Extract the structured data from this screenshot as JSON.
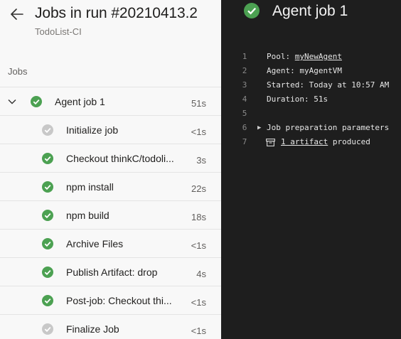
{
  "header": {
    "title": "Jobs in run #20210413.2",
    "subtitle": "TodoList-CI"
  },
  "jobs_section": {
    "label": "Jobs",
    "job": {
      "name": "Agent job 1",
      "duration": "51s",
      "status": "succeeded"
    },
    "steps": [
      {
        "name": "Initialize job",
        "duration": "<1s",
        "status": "skipped"
      },
      {
        "name": "Checkout thinkC/todolist",
        "display": "Checkout thinkC/todoli...",
        "duration": "3s",
        "status": "succeeded"
      },
      {
        "name": "npm install",
        "duration": "22s",
        "status": "succeeded"
      },
      {
        "name": "npm build",
        "duration": "18s",
        "status": "succeeded"
      },
      {
        "name": "Archive Files",
        "duration": "<1s",
        "status": "succeeded"
      },
      {
        "name": "Publish Artifact: drop",
        "duration": "4s",
        "status": "succeeded"
      },
      {
        "name": "Post-job: Checkout thinkC/todolist",
        "display": "Post-job: Checkout thi...",
        "duration": "<1s",
        "status": "succeeded"
      },
      {
        "name": "Finalize Job",
        "duration": "<1s",
        "status": "skipped"
      }
    ]
  },
  "detail": {
    "title": "Agent job 1",
    "log": {
      "line_numbers": [
        "1",
        "2",
        "3",
        "4",
        "5",
        "6",
        "7"
      ],
      "pool_label": "Pool: ",
      "pool_value": "myNewAgent",
      "agent_text": "Agent: myAgentVM",
      "started_text": "Started: Today at 10:57 AM",
      "duration_text": "Duration: 51s",
      "job_prep_text": "Job preparation parameters",
      "artifact_link": "1 artifact",
      "artifact_suffix": " produced"
    }
  },
  "colors": {
    "success": "#4ca152",
    "skipped": "#c8c8c8",
    "left_bg": "#f8f8f8",
    "right_bg": "#1e1e1e"
  },
  "icons": {
    "back": "arrow-left-icon",
    "expand": "chevron-down-icon",
    "success": "check-circle-icon",
    "skipped": "skipped-circle-icon",
    "expander": "triangle-right-icon",
    "artifact": "archive-icon"
  }
}
